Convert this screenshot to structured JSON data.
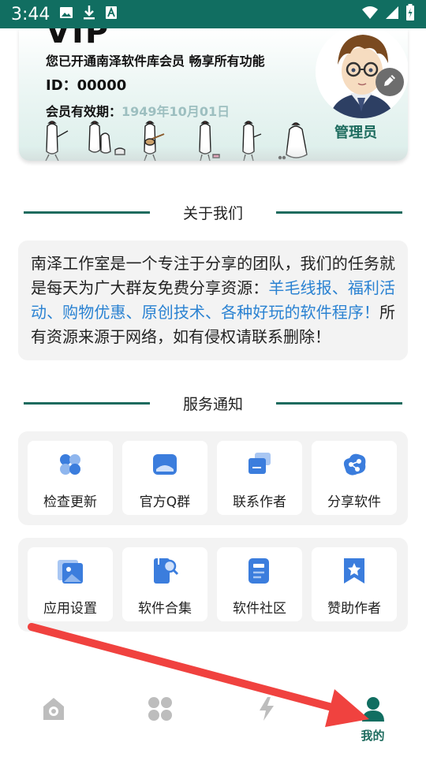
{
  "status_bar": {
    "time": "3:44"
  },
  "vip_card": {
    "title": "VIP",
    "slogan": "您已开通南泽软件库会员 畅享所有功能",
    "id_text": "ID：00000",
    "expiry_label": "会员有效期：",
    "expiry_date": "1949年10月01日",
    "role": "管理员"
  },
  "about": {
    "heading": "关于我们",
    "text_before": "南泽工作室是一个专注于分享的团队，我们的任务就是每天为广大群友免费分享资源：",
    "text_highlight": "羊毛线报、福利活动、购物优惠、原创技术、各种好玩的软件程序！",
    "text_after": "所有资源来源于网络，如有侵权请联系删除！"
  },
  "services": {
    "heading": "服务通知",
    "row1": [
      {
        "label": "检查更新",
        "icon": "clover-icon"
      },
      {
        "label": "官方Q群",
        "icon": "chat-window-icon"
      },
      {
        "label": "联系作者",
        "icon": "message-icon"
      },
      {
        "label": "分享软件",
        "icon": "share-cloud-icon"
      }
    ],
    "row2": [
      {
        "label": "应用设置",
        "icon": "image-settings-icon"
      },
      {
        "label": "软件合集",
        "icon": "collection-search-icon"
      },
      {
        "label": "软件社区",
        "icon": "document-icon"
      },
      {
        "label": "赞助作者",
        "icon": "star-bookmark-icon"
      }
    ]
  },
  "bottom_nav": {
    "items": [
      {
        "label": "",
        "icon": "camera-home-icon"
      },
      {
        "label": "",
        "icon": "grid-icon"
      },
      {
        "label": "",
        "icon": "lightning-icon"
      },
      {
        "label": "我的",
        "icon": "person-icon",
        "active": true
      }
    ]
  },
  "colors": {
    "primary": "#116e61",
    "highlight": "#2a82d2",
    "icon_blue": "#3b7ddd",
    "arrow": "#f0423f",
    "expiry": "#9dbfc0"
  }
}
